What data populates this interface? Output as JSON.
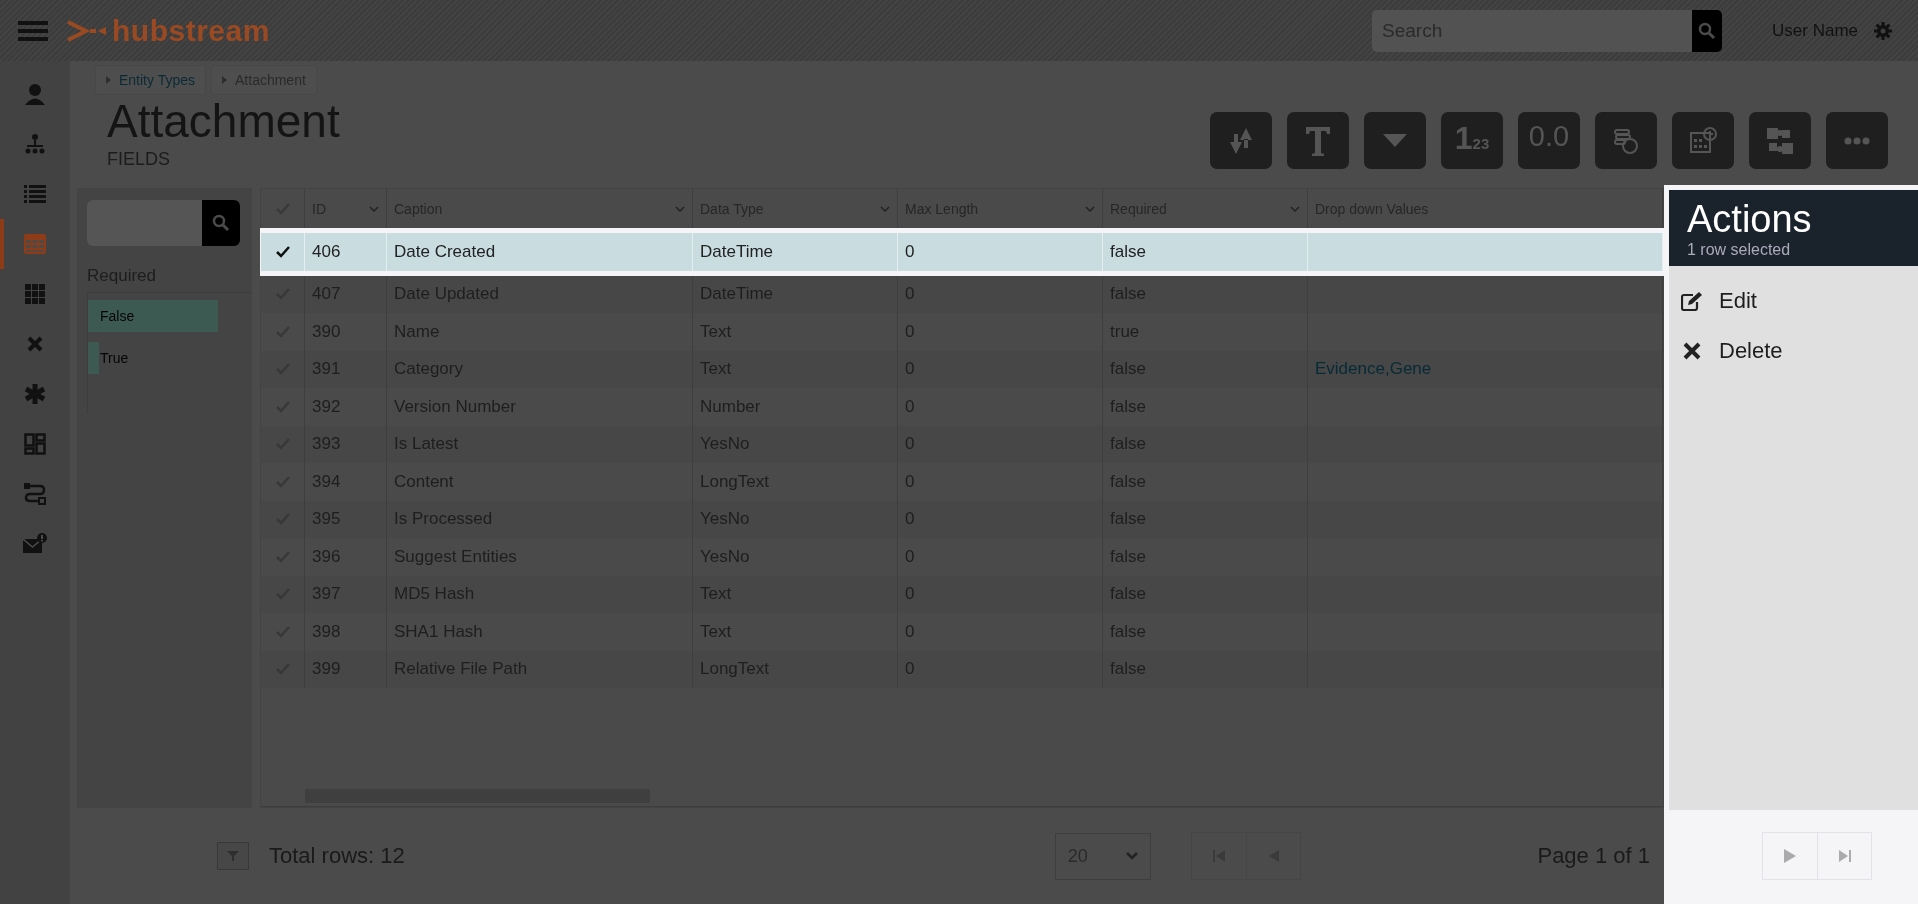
{
  "header": {
    "logo": "hubstream",
    "search": {
      "placeholder": "Search"
    },
    "user": "User Name"
  },
  "sidebar": {
    "items": [
      {
        "kind": "person",
        "selected": false
      },
      {
        "kind": "hierarchy",
        "selected": false
      },
      {
        "kind": "list",
        "selected": false
      },
      {
        "kind": "table",
        "selected": true
      },
      {
        "kind": "grid",
        "selected": false
      },
      {
        "kind": "cross",
        "selected": false
      },
      {
        "kind": "asterisk",
        "selected": false
      },
      {
        "kind": "dashboard",
        "selected": false
      },
      {
        "kind": "flow",
        "selected": false
      },
      {
        "kind": "mail-alert",
        "selected": false
      }
    ]
  },
  "breadcrumbs": [
    {
      "label": "Entity Types",
      "kind": "link"
    },
    {
      "label": "Attachment",
      "kind": "current"
    }
  ],
  "title": "Attachment",
  "subtitle": "FIELDS",
  "toolbar": [
    {
      "kind": "reorder"
    },
    {
      "kind": "text"
    },
    {
      "kind": "dropdown"
    },
    {
      "kind": "integer",
      "label": "1",
      "sub": "23"
    },
    {
      "kind": "decimal",
      "label": "0.0"
    },
    {
      "kind": "coins"
    },
    {
      "kind": "calendar"
    },
    {
      "kind": "puzzle"
    },
    {
      "kind": "more"
    }
  ],
  "filter": {
    "title": "Required",
    "options": [
      {
        "label": "False",
        "level": 0.8
      },
      {
        "label": "True",
        "level": 0.07
      }
    ]
  },
  "table": {
    "select_all": {
      "checked": false
    },
    "columns": [
      {
        "label": "ID",
        "menu": true
      },
      {
        "label": "Caption",
        "menu": true
      },
      {
        "label": "Data Type",
        "menu": true
      },
      {
        "label": "Max Length",
        "menu": true
      },
      {
        "label": "Required",
        "menu": true
      },
      {
        "label": "Drop down Values",
        "menu": false
      }
    ],
    "rows": [
      {
        "selected": true,
        "cells": [
          "406",
          "Date Created",
          "DateTime",
          "0",
          "false",
          ""
        ]
      },
      {
        "selected": false,
        "cells": [
          "407",
          "Date Updated",
          "DateTime",
          "0",
          "false",
          ""
        ]
      },
      {
        "selected": false,
        "cells": [
          "390",
          "Name",
          "Text",
          "0",
          "true",
          ""
        ]
      },
      {
        "selected": false,
        "cells": [
          "391",
          "Category",
          "Text",
          "0",
          "false",
          "Evidence,Gene"
        ]
      },
      {
        "selected": false,
        "cells": [
          "392",
          "Version Number",
          "Number",
          "0",
          "false",
          ""
        ]
      },
      {
        "selected": false,
        "cells": [
          "393",
          "Is Latest",
          "YesNo",
          "0",
          "false",
          ""
        ]
      },
      {
        "selected": false,
        "cells": [
          "394",
          "Content",
          "LongText",
          "0",
          "false",
          ""
        ]
      },
      {
        "selected": false,
        "cells": [
          "395",
          "Is Processed",
          "YesNo",
          "0",
          "false",
          ""
        ]
      },
      {
        "selected": false,
        "cells": [
          "396",
          "Suggest Entities",
          "YesNo",
          "0",
          "false",
          ""
        ]
      },
      {
        "selected": false,
        "cells": [
          "397",
          "MD5 Hash",
          "Text",
          "0",
          "false",
          ""
        ]
      },
      {
        "selected": false,
        "cells": [
          "398",
          "SHA1 Hash",
          "Text",
          "0",
          "false",
          ""
        ]
      },
      {
        "selected": false,
        "cells": [
          "399",
          "Relative File Path",
          "LongText",
          "0",
          "false",
          ""
        ]
      }
    ]
  },
  "footer": {
    "total": "Total rows: 12",
    "page_size": "20",
    "page": "Page 1 of 1"
  },
  "actions": {
    "title": "Actions",
    "subtitle": "1 row selected",
    "items": [
      {
        "kind": "edit",
        "label": "Edit"
      },
      {
        "kind": "delete",
        "label": "Delete"
      }
    ]
  }
}
